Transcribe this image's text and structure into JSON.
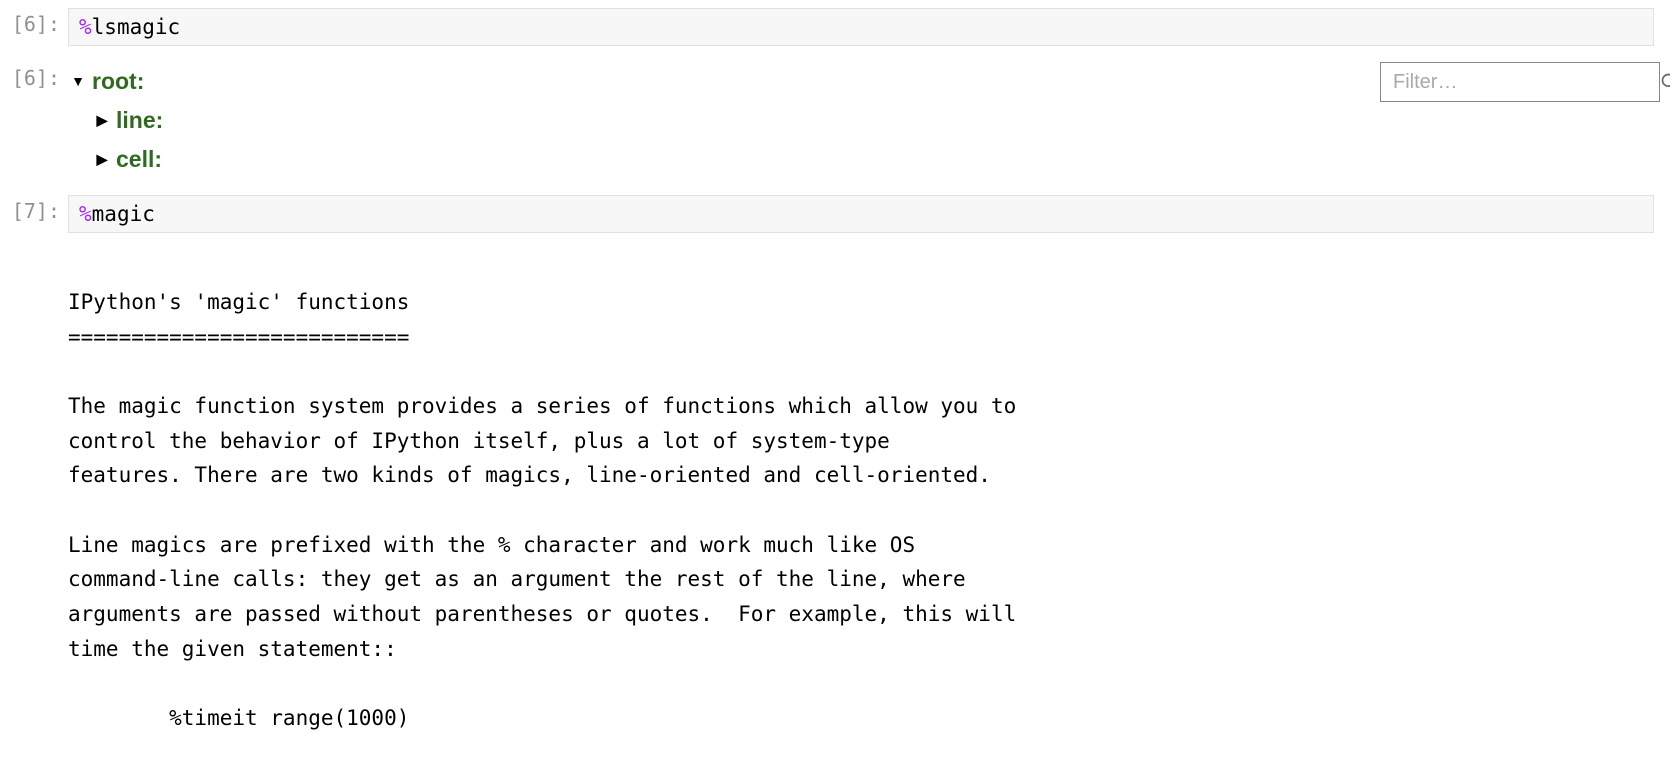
{
  "cells": {
    "c6_in": {
      "prompt": "[6]:",
      "percent": "%",
      "cmd": "lsmagic"
    },
    "c6_out": {
      "prompt": "[6]:",
      "filter_placeholder": "Filter…",
      "tree": {
        "root": "root:",
        "line": "line:",
        "cell": "cell:"
      }
    },
    "c7_in": {
      "prompt": "[7]:",
      "percent": "%",
      "cmd": "magic"
    },
    "c7_out": {
      "text": "IPython's 'magic' functions\n===========================\n\nThe magic function system provides a series of functions which allow you to\ncontrol the behavior of IPython itself, plus a lot of system-type\nfeatures. There are two kinds of magics, line-oriented and cell-oriented.\n\nLine magics are prefixed with the % character and work much like OS\ncommand-line calls: they get as an argument the rest of the line, where\narguments are passed without parentheses or quotes.  For example, this will\ntime the given statement::\n\n        %timeit range(1000)"
    }
  }
}
